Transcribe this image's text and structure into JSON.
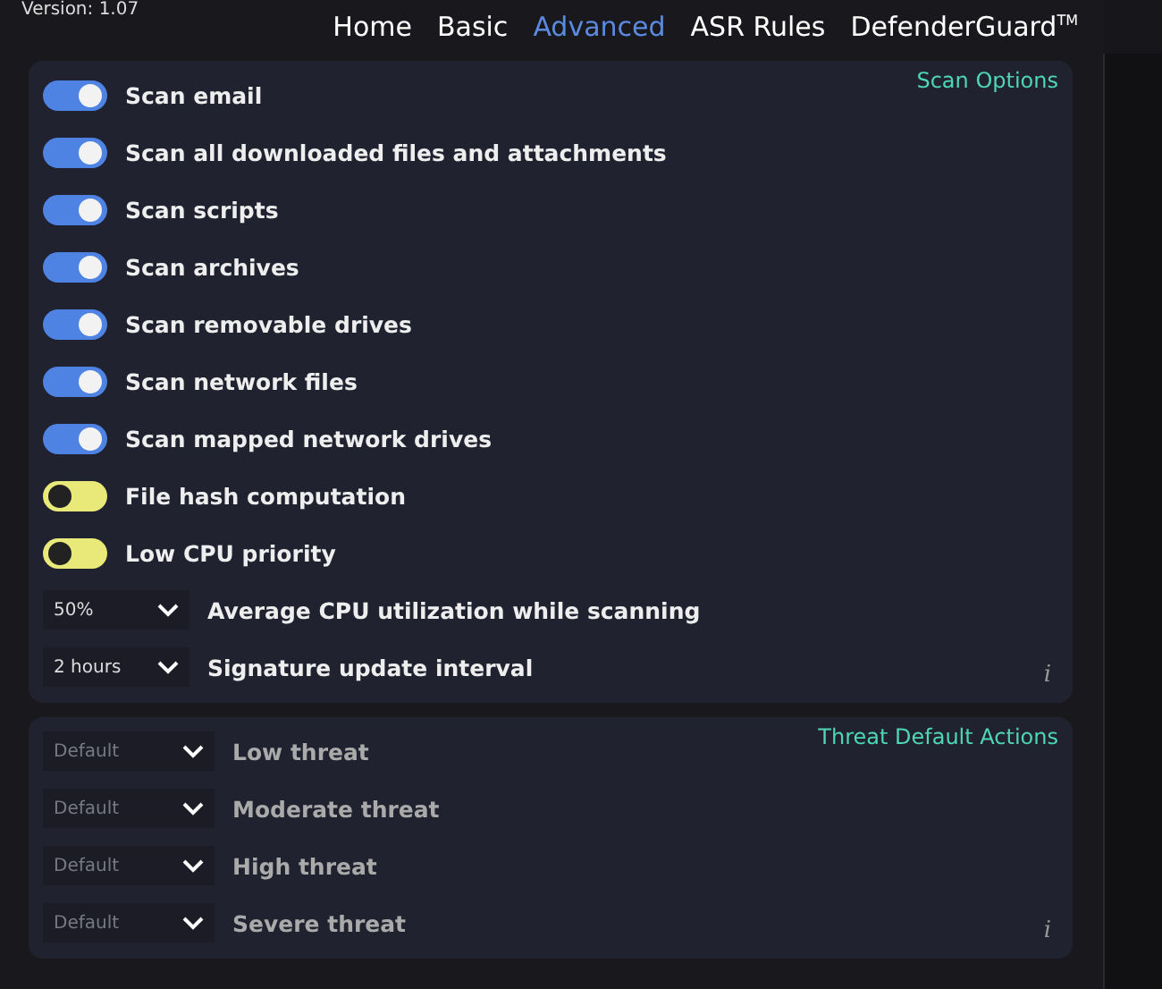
{
  "version": "Version: 1.07",
  "nav": [
    {
      "label": "Home",
      "selected": false
    },
    {
      "label": "Basic",
      "selected": false
    },
    {
      "label": "Advanced",
      "selected": true
    },
    {
      "label": "ASR Rules",
      "selected": false
    },
    {
      "label": "DefenderGuard",
      "selected": false,
      "sup": "TM"
    }
  ],
  "scan_options": {
    "title": "Scan Options",
    "items": [
      {
        "kind": "toggle",
        "label": "Scan email",
        "on": true
      },
      {
        "kind": "toggle",
        "label": "Scan all downloaded files and attachments",
        "on": true
      },
      {
        "kind": "toggle",
        "label": "Scan scripts",
        "on": true
      },
      {
        "kind": "toggle",
        "label": "Scan archives",
        "on": true
      },
      {
        "kind": "toggle",
        "label": "Scan removable drives",
        "on": true
      },
      {
        "kind": "toggle",
        "label": "Scan network files",
        "on": true
      },
      {
        "kind": "toggle",
        "label": "Scan mapped network drives",
        "on": true
      },
      {
        "kind": "toggle",
        "label": "File hash computation",
        "on": false
      },
      {
        "kind": "toggle",
        "label": "Low CPU priority",
        "on": false
      },
      {
        "kind": "dropdown",
        "label": "Average CPU utilization while scanning",
        "value": "50%",
        "disabled": false
      },
      {
        "kind": "dropdown",
        "label": "Signature update interval",
        "value": "2 hours",
        "disabled": false
      }
    ],
    "info": "i"
  },
  "threat_actions": {
    "title": "Threat Default Actions",
    "items": [
      {
        "kind": "dropdown",
        "label": "Low threat",
        "value": "Default",
        "disabled": true
      },
      {
        "kind": "dropdown",
        "label": "Moderate threat",
        "value": "Default",
        "disabled": true
      },
      {
        "kind": "dropdown",
        "label": "High threat",
        "value": "Default",
        "disabled": true
      },
      {
        "kind": "dropdown",
        "label": "Severe threat",
        "value": "Default",
        "disabled": true
      }
    ],
    "info": "i"
  }
}
